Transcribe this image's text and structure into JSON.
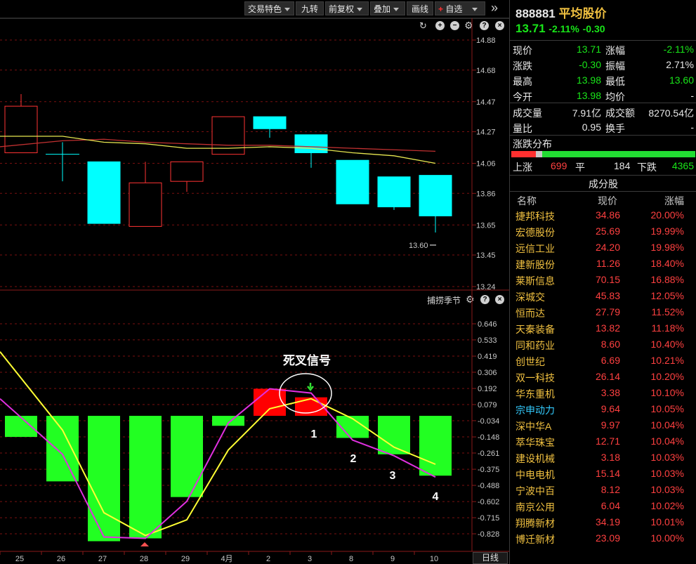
{
  "toolbar": {
    "items": [
      "交易特色",
      "九转",
      "前复权",
      "叠加",
      "画线",
      "自选"
    ],
    "more_icon": "double-chevron-right-icon"
  },
  "indicator_title": "捕捞季节",
  "bottom_tab": "日线",
  "annotations": {
    "death_cross": "死叉信号",
    "steps": [
      "1",
      "2",
      "3",
      "4"
    ]
  },
  "stock": {
    "code": "888881",
    "name": "平均股价",
    "price": "13.71",
    "pct": "-2.11%",
    "change": "-0.30"
  },
  "quote": {
    "xianjia_label": "现价",
    "xianjia": "13.71",
    "zhangfu_label": "涨幅",
    "zhangfu": "-2.11%",
    "zhangdie_label": "涨跌",
    "zhangdie": "-0.30",
    "zhenfu_label": "振幅",
    "zhenfu": "2.71%",
    "zuigao_label": "最高",
    "zuigao": "13.98",
    "zuidi_label": "最低",
    "zuidi": "13.60",
    "jinkai_label": "今开",
    "jinkai": "13.98",
    "junjia_label": "均价",
    "junjia": "-",
    "chengjiaoliang_label": "成交量",
    "chengjiaoliang": "7.91亿",
    "chengjiaoe_label": "成交额",
    "chengjiaoe": "8270.54亿",
    "liangbi_label": "量比",
    "liangbi": "0.95",
    "huanshou_label": "换手",
    "huanshou": "-"
  },
  "distribution": {
    "title": "涨跌分布",
    "up_label": "上涨",
    "up": "699",
    "flat_label": "平",
    "flat": "184",
    "down_label": "下跌",
    "down": "4365",
    "up_frac": 0.133,
    "flat_frac": 0.035,
    "down_frac": 0.832
  },
  "components": {
    "title": "成分股",
    "headers": [
      "名称",
      "现价",
      "涨幅"
    ],
    "rows": [
      {
        "name": "捷邦科技",
        "price": "34.86",
        "pct": "20.00%"
      },
      {
        "name": "宏德股份",
        "price": "25.69",
        "pct": "19.99%"
      },
      {
        "name": "远信工业",
        "price": "24.20",
        "pct": "19.98%"
      },
      {
        "name": "建新股份",
        "price": "11.26",
        "pct": "18.40%"
      },
      {
        "name": "莱斯信息",
        "price": "70.15",
        "pct": "16.88%"
      },
      {
        "name": "深城交",
        "price": "45.83",
        "pct": "12.05%"
      },
      {
        "name": "恒而达",
        "price": "27.79",
        "pct": "11.52%"
      },
      {
        "name": "天秦装备",
        "price": "13.82",
        "pct": "11.18%"
      },
      {
        "name": "同和药业",
        "price": "8.60",
        "pct": "10.40%"
      },
      {
        "name": "创世纪",
        "price": "6.69",
        "pct": "10.21%"
      },
      {
        "name": "双一科技",
        "price": "26.14",
        "pct": "10.20%"
      },
      {
        "name": "华东重机",
        "price": "3.38",
        "pct": "10.10%"
      },
      {
        "name": "宗申动力",
        "price": "9.64",
        "pct": "10.05%",
        "highlight": true
      },
      {
        "name": "深中华A",
        "price": "9.97",
        "pct": "10.04%"
      },
      {
        "name": "萃华珠宝",
        "price": "12.71",
        "pct": "10.04%"
      },
      {
        "name": "建设机械",
        "price": "3.18",
        "pct": "10.03%"
      },
      {
        "name": "中电电机",
        "price": "15.14",
        "pct": "10.03%"
      },
      {
        "name": "宁波中百",
        "price": "8.12",
        "pct": "10.03%"
      },
      {
        "name": "南京公用",
        "price": "6.04",
        "pct": "10.02%"
      },
      {
        "name": "翔腾新材",
        "price": "34.19",
        "pct": "10.01%"
      },
      {
        "name": "博迁新材",
        "price": "23.09",
        "pct": "10.00%"
      }
    ]
  },
  "colors": {
    "up": "#ff3333",
    "down": "#00ffff",
    "macd_up": "#ff0000",
    "macd_down": "#22ff22",
    "ma_red": "#c03030",
    "ma_yellow": "#e6e650",
    "line_yellow": "#ffff33",
    "line_magenta": "#e030e0",
    "grid": "#7a1010",
    "axis_text": "#c8c8c8"
  },
  "chart_data": [
    {
      "type": "candlestick",
      "categories": [
        "25",
        "26",
        "27",
        "28",
        "29",
        "4月",
        "2",
        "3",
        "8",
        "9",
        "10"
      ],
      "yticks": [
        14.88,
        14.68,
        14.47,
        14.27,
        14.06,
        13.86,
        13.65,
        13.45,
        13.24
      ],
      "ylim": [
        13.24,
        14.88
      ],
      "low_label": "13.60",
      "candles": [
        {
          "open": 14.13,
          "close": 14.44,
          "high": 14.52,
          "low": 14.13
        },
        {
          "open": 14.12,
          "close": 14.12,
          "high": 14.2,
          "low": 13.94
        },
        {
          "open": 14.07,
          "close": 13.66,
          "high": 14.07,
          "low": 13.66
        },
        {
          "open": 13.64,
          "close": 13.93,
          "high": 14.07,
          "low": 13.64
        },
        {
          "open": 13.94,
          "close": 14.07,
          "high": 14.07,
          "low": 13.87
        },
        {
          "open": 14.12,
          "close": 14.37,
          "high": 14.37,
          "low": 14.12
        },
        {
          "open": 14.37,
          "close": 14.29,
          "high": 14.37,
          "low": 14.23
        },
        {
          "open": 14.25,
          "close": 14.13,
          "high": 14.25,
          "low": 14.03
        },
        {
          "open": 14.08,
          "close": 13.79,
          "high": 14.08,
          "low": 13.79
        },
        {
          "open": 13.97,
          "close": 13.77,
          "high": 13.97,
          "low": 13.75
        },
        {
          "open": 13.98,
          "close": 13.71,
          "high": 13.98,
          "low": 13.6
        }
      ],
      "ma_red": [
        14.17,
        14.21,
        14.22,
        14.2,
        14.19,
        14.18,
        14.18,
        14.17,
        14.16,
        14.15,
        14.14
      ],
      "ma_yellow": [
        14.24,
        14.24,
        14.2,
        14.19,
        14.16,
        14.16,
        14.17,
        14.16,
        14.13,
        14.11,
        14.06
      ]
    },
    {
      "type": "bar",
      "title": "捕捞季节",
      "categories": [
        "25",
        "26",
        "27",
        "28",
        "29",
        "4月",
        "2",
        "3",
        "8",
        "9",
        "10"
      ],
      "yticks": [
        0.646,
        0.533,
        0.419,
        0.306,
        0.192,
        0.079,
        -0.034,
        -0.148,
        -0.261,
        -0.375,
        -0.488,
        -0.602,
        -0.715,
        -0.828
      ],
      "ylim": [
        -0.9,
        0.72
      ],
      "values": [
        -0.148,
        -0.46,
        -0.88,
        -0.86,
        -0.57,
        -0.07,
        0.19,
        0.13,
        -0.155,
        -0.27,
        -0.42
      ],
      "line_yellow": [
        0.36,
        -0.1,
        -0.68,
        -0.84,
        -0.73,
        -0.24,
        0.05,
        0.12,
        -0.02,
        -0.22,
        -0.34
      ],
      "line_magenta": [
        0.07,
        -0.27,
        -0.85,
        -0.86,
        -0.6,
        -0.05,
        0.19,
        0.16,
        -0.17,
        -0.28,
        -0.43
      ]
    }
  ]
}
